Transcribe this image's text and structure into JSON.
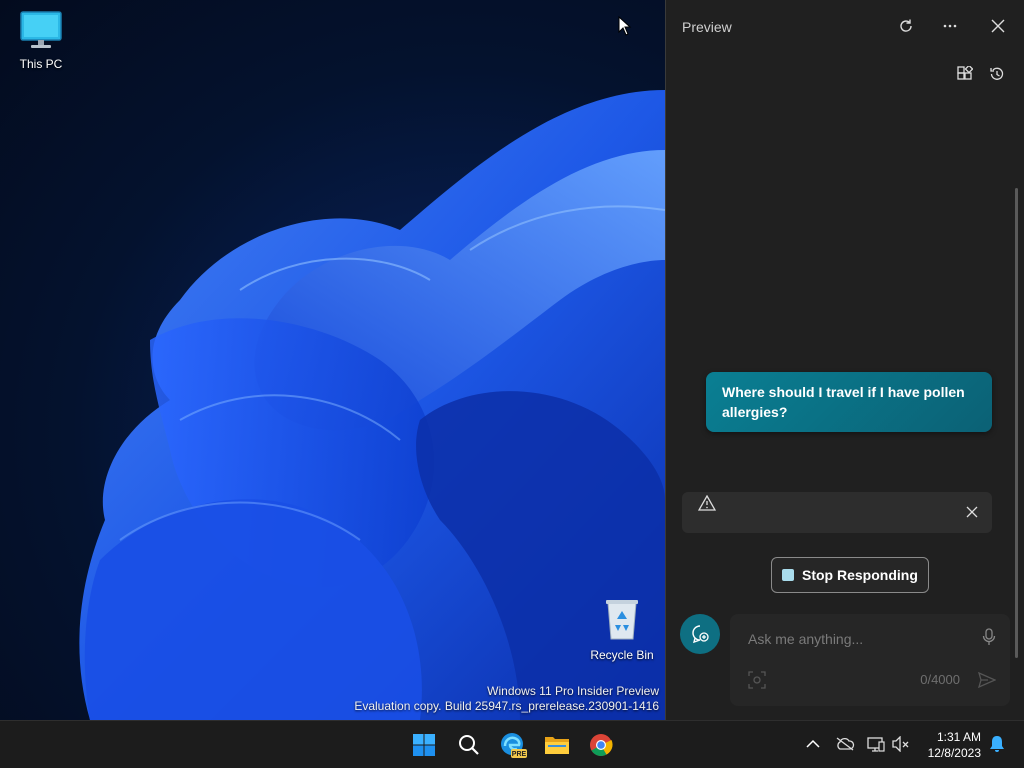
{
  "desktop": {
    "icons": [
      {
        "label": "This PC",
        "icon": "monitor-icon"
      },
      {
        "label": "Recycle Bin",
        "icon": "recycle-bin-icon"
      }
    ],
    "watermark": {
      "line1": "Windows 11 Pro Insider Preview",
      "line2": "Evaluation copy. Build 25947.rs_prerelease.230901-1416"
    }
  },
  "copilot": {
    "title": "Preview",
    "header_buttons": [
      "refresh-icon",
      "more-icon",
      "close-icon"
    ],
    "sub_buttons": [
      "plugins-icon",
      "history-icon"
    ],
    "user_message": "Where should I travel if I have pollen allergies?",
    "warning": {
      "icon": "warning-icon",
      "text": ""
    },
    "stop_button": "Stop Responding",
    "input": {
      "placeholder": "Ask me anything...",
      "value": ""
    },
    "char_counter": "0/4000",
    "colors": {
      "accent": "#0a7f93",
      "panel_bg": "#202020"
    }
  },
  "taskbar": {
    "apps": [
      "start-icon",
      "search-icon",
      "edge-preview-icon",
      "file-explorer-icon",
      "chrome-icon"
    ],
    "edge_badge": "PRE",
    "tray": [
      "show-hidden-icons",
      "onedrive-icon",
      "network-icon",
      "volume-muted-icon"
    ],
    "time": "1:31 AM",
    "date": "12/8/2023"
  }
}
